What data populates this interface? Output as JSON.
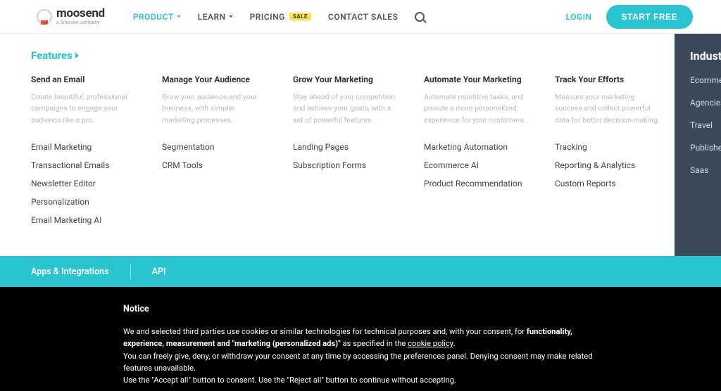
{
  "header": {
    "logo": {
      "name": "moosend",
      "sub": "a Sitecore company"
    },
    "nav": {
      "product": "PRODUCT",
      "learn": "LEARN",
      "pricing": "PRICING",
      "pricing_badge": "SALE",
      "contact": "CONTACT SALES"
    },
    "login": "LOGIN",
    "start_free": "START FREE"
  },
  "mega": {
    "features_title": "Features",
    "columns": [
      {
        "title": "Send an Email",
        "desc": "Create beautiful, professional campaigns to engage your audience like a pro.",
        "links": [
          "Email Marketing",
          "Transactional Emails",
          "Newsletter Editor",
          "Personalization",
          "Email Marketing AI"
        ]
      },
      {
        "title": "Manage Your Audience",
        "desc": "Grow your audience and your business, with simpler marketing processes.",
        "links": [
          "Segmentation",
          "CRM Tools"
        ]
      },
      {
        "title": "Grow Your Marketing",
        "desc": "Stay ahead of your competition and achieve your goals, with a set of powerful features.",
        "links": [
          "Landing Pages",
          "Subscription Forms"
        ]
      },
      {
        "title": "Automate Your Marketing",
        "desc": "Automate repetitive tasks, and provide a more personalized experience for your customers.",
        "links": [
          "Marketing Automation",
          "Ecommerce AI",
          "Product Recommendation"
        ]
      },
      {
        "title": "Track Your Efforts",
        "desc": "Measure your marketing success and collect powerful data for better decision-making.",
        "links": [
          "Tracking",
          "Reporting & Analytics",
          "Custom Reports"
        ]
      }
    ],
    "industries": {
      "title": "Industries",
      "items": [
        "Ecommerce",
        "Agencies",
        "Travel",
        "Publishers",
        "Saas"
      ]
    },
    "footer": {
      "apps": "Apps & Integrations",
      "api": "API"
    }
  },
  "cookie": {
    "title": "Notice",
    "line1a": "We and selected third parties use cookies or similar technologies for technical purposes and, with your consent, for ",
    "line1b": "functionality, experience, measurement and \"marketing (personalized ads)\"",
    "line1c": " as specified in the ",
    "policy": "cookie policy",
    "line2": "You can freely give, deny, or withdraw your consent at any time by accessing the preferences panel. Denying consent may make related features unavailable.",
    "line3": "Use the \"Accept all\" button to consent. Use the \"Reject all\" button to continue without accepting."
  }
}
